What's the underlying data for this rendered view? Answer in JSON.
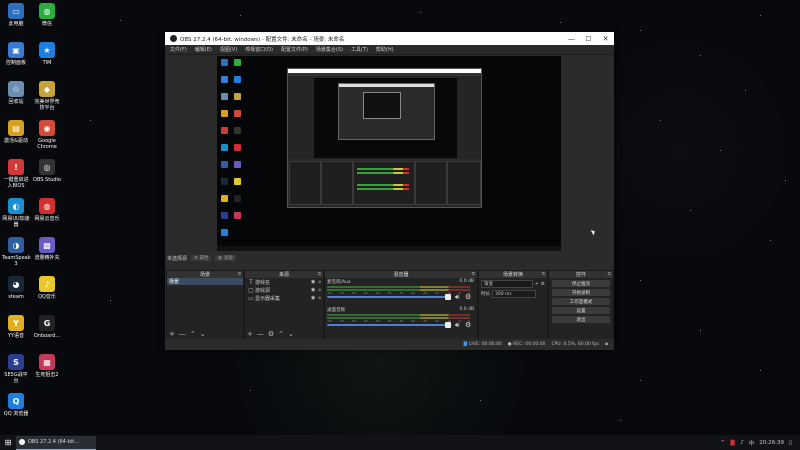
{
  "desktop": {
    "icons": [
      {
        "label": "此电脑",
        "glyph": "▭",
        "color": "#2c6fbf"
      },
      {
        "label": "微信",
        "glyph": "◍",
        "color": "#2aae3d"
      },
      {
        "label": "控制面板",
        "glyph": "▣",
        "color": "#3a7bd5"
      },
      {
        "label": "TIM",
        "glyph": "★",
        "color": "#1d7fe0"
      },
      {
        "label": "回收站",
        "glyph": "♲",
        "color": "#6a8fb3"
      },
      {
        "label": "完美世界竞技平台",
        "glyph": "◆",
        "color": "#c8a23a"
      },
      {
        "label": "激活&驱动",
        "glyph": "▤",
        "color": "#d9a020"
      },
      {
        "label": "Google Chrome",
        "glyph": "◉",
        "color": "#d64a3a"
      },
      {
        "label": "一键重启进入BIOS",
        "glyph": "!",
        "color": "#d23a3a"
      },
      {
        "label": "OBS Studio",
        "glyph": "◎",
        "color": "#333333"
      },
      {
        "label": "网易UU加速器",
        "glyph": "◐",
        "color": "#1a8fd0"
      },
      {
        "label": "网易云音乐",
        "glyph": "◍",
        "color": "#d22f2f"
      },
      {
        "label": "TeamSpeak 3",
        "glyph": "◑",
        "color": "#2f5f9f"
      },
      {
        "label": "流量精补充",
        "glyph": "▩",
        "color": "#6a5ac8"
      },
      {
        "label": "steam",
        "glyph": "◕",
        "color": "#1b2838"
      },
      {
        "label": "QQ音乐",
        "glyph": "♪",
        "color": "#e9c82a"
      },
      {
        "label": "YY语音",
        "glyph": "Y",
        "color": "#e0b020"
      },
      {
        "label": "Onboard...",
        "glyph": "G",
        "color": "#222222"
      },
      {
        "label": "SE5G战平台",
        "glyph": "S",
        "color": "#2a3f8f"
      },
      {
        "label": "生死狙击2",
        "glyph": "▦",
        "color": "#c43a5a"
      },
      {
        "label": "QQ 浏览器",
        "glyph": "Q",
        "color": "#1f7fe0"
      }
    ]
  },
  "obs": {
    "title": "OBS 27.2.4 (64-bit, windows) - 配置文件: 未命名 - 场景: 未命名",
    "window_buttons": {
      "minimize": "—",
      "maximize": "☐",
      "close": "✕"
    },
    "menu": [
      "文件(F)",
      "编辑(E)",
      "视图(V)",
      "停靠窗口(D)",
      "配置文件(P)",
      "场景集合(S)",
      "工具(T)",
      "帮助(H)"
    ],
    "scene_bar": {
      "scene_name": "未选择源",
      "properties_label": "属性",
      "filters_label": "滤镜"
    },
    "docks": {
      "scenes": {
        "title": "场景",
        "items": [
          "场景"
        ]
      },
      "sources": {
        "title": "来源",
        "items": [
          {
            "icon": "T",
            "label": "游戏名"
          },
          {
            "icon": "▢",
            "label": "游戏源"
          },
          {
            "icon": "▭",
            "label": "显示器采集"
          }
        ]
      },
      "mixer": {
        "title": "混音器",
        "channels": [
          {
            "name": "麦克风/Aux",
            "db": "0.0 dB"
          },
          {
            "name": "桌面音频",
            "db": "0.0 dB"
          }
        ],
        "ticks": [
          "-60",
          "-55",
          "-50",
          "-45",
          "-40",
          "-35",
          "-30",
          "-25",
          "-20",
          "-15",
          "-10",
          "-5",
          "0"
        ]
      },
      "transitions": {
        "title": "场景转换",
        "type": "渐变",
        "duration_label": "时长",
        "duration_value": "300 ms"
      },
      "controls": {
        "title": "控件",
        "buttons": [
          "停止推流",
          "开始录制",
          "工作室模式",
          "设置",
          "退出"
        ]
      }
    },
    "dock_footer": {
      "add": "+",
      "remove": "—",
      "up": "⌃",
      "down": "⌄",
      "gear": "⚙"
    },
    "status": {
      "live": "LIVE: 00:00:00",
      "rec": "REC: 00:00:00",
      "cpu": "CPU: 0.5%, 60.00 fps"
    }
  },
  "taskbar": {
    "start_glyph": "⊞",
    "task_label": "OBS 27.2.4 (64-bit...",
    "time": "20:26:39",
    "tray": [
      "⌃",
      "◙",
      "♪",
      "中"
    ]
  }
}
